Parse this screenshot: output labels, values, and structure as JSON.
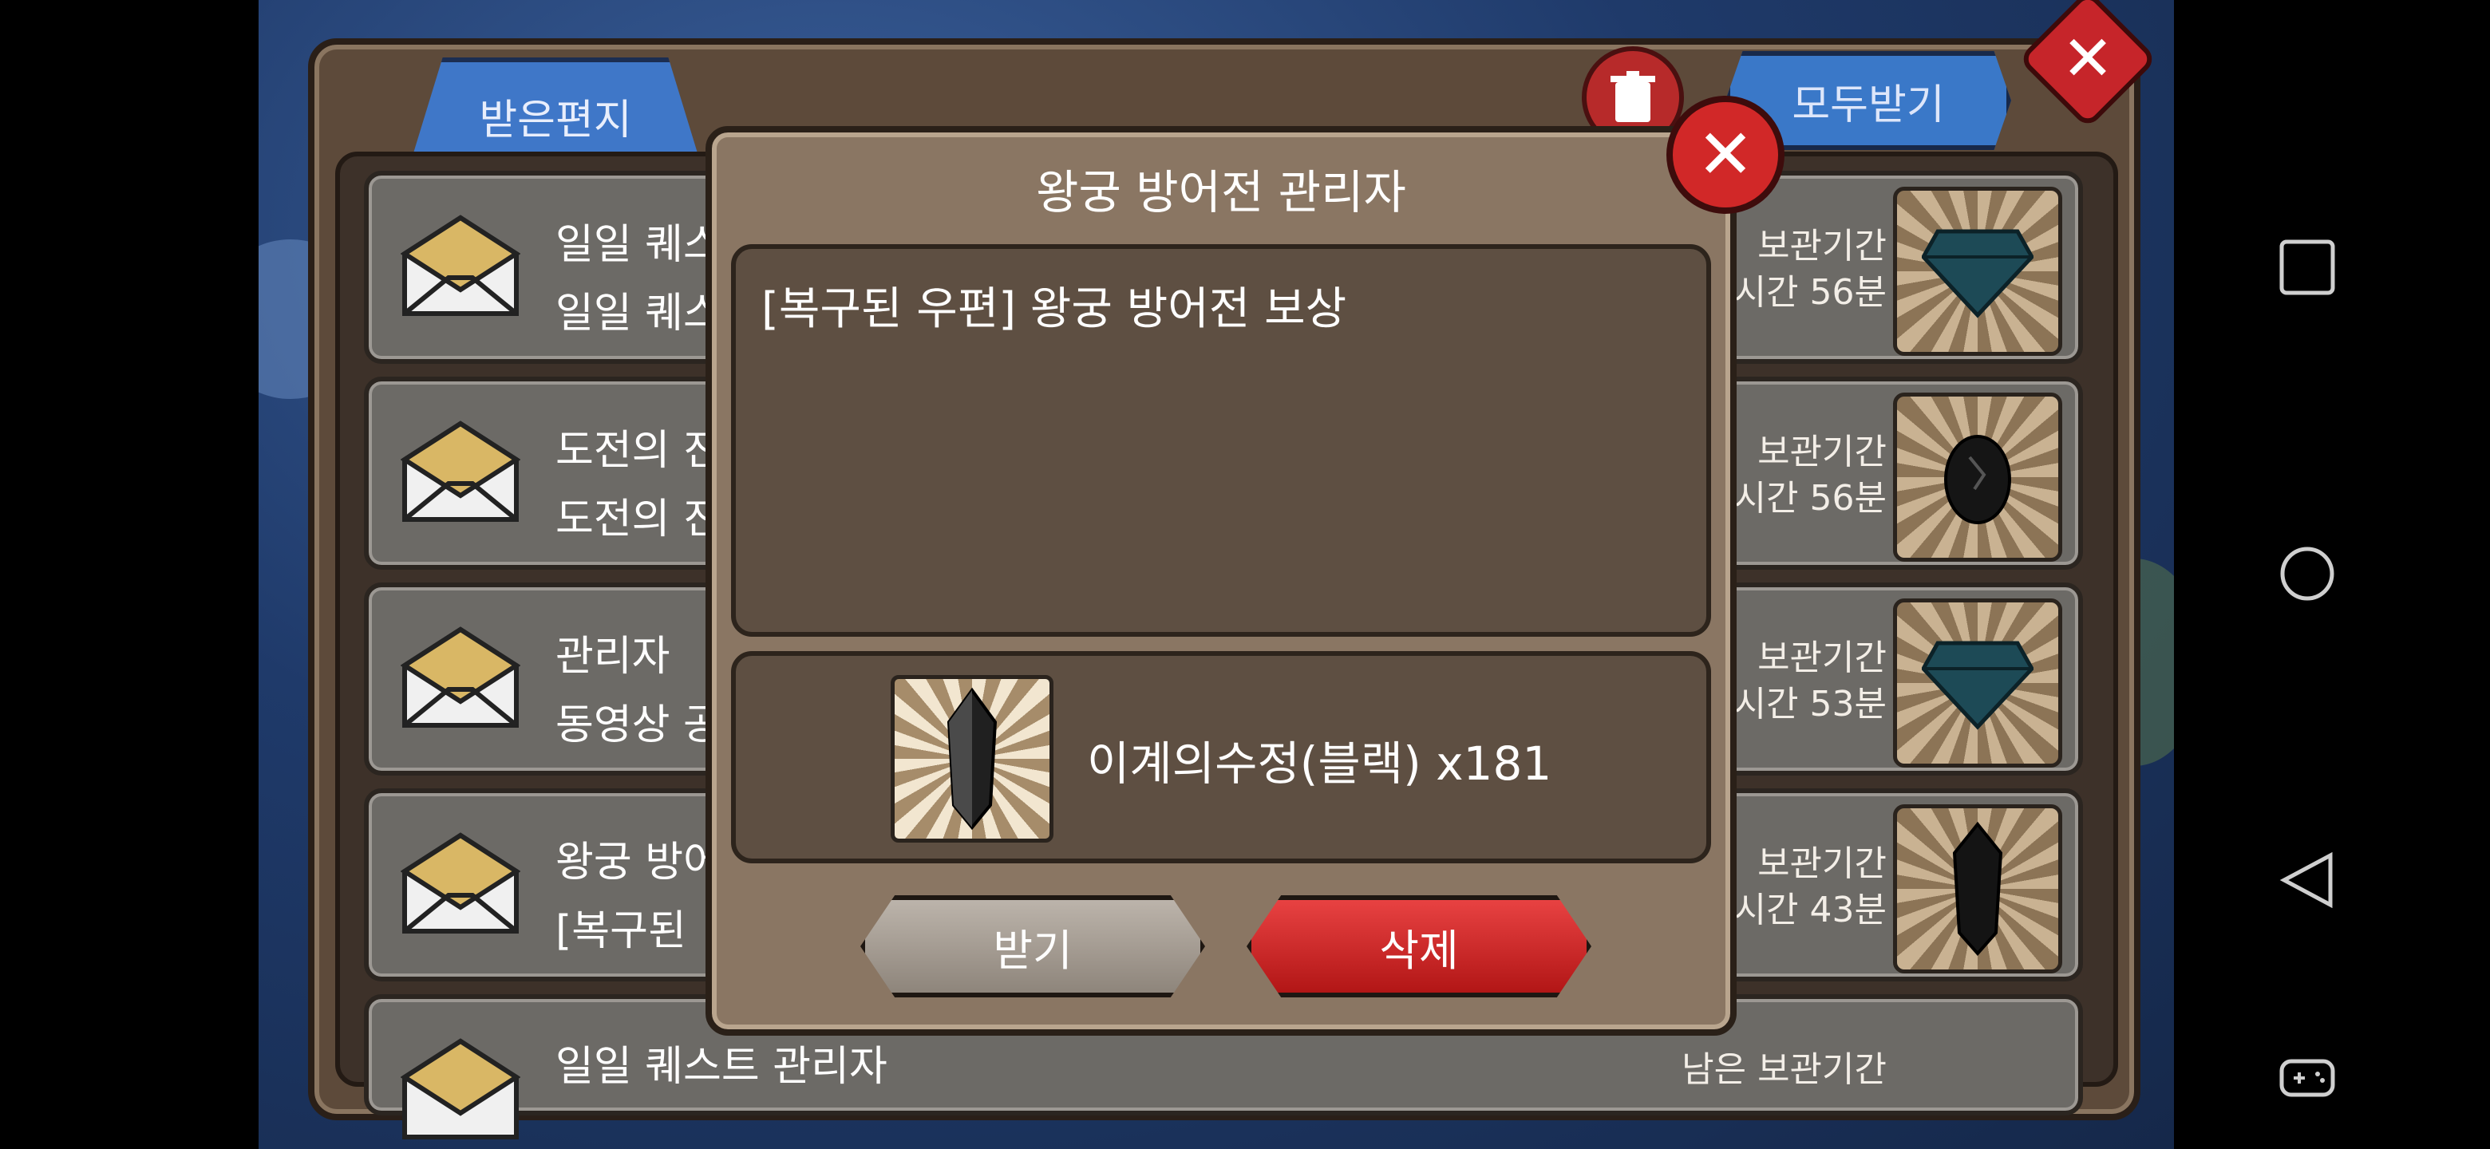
{
  "mail_panel": {
    "tab_label": "받은편지",
    "receive_all_label": "모두받기",
    "rows": [
      {
        "line1": "일일 퀘스",
        "line2": "일일 퀘스",
        "right1": "보관기간",
        "right2": "시간 56분",
        "item_icon": "diamond-icon"
      },
      {
        "line1": "도전의 진",
        "line2": "도전의 진",
        "right1": "보관기간",
        "right2": "시간 56분",
        "item_icon": "egg-icon"
      },
      {
        "line1": "관리자",
        "line2": "동영상 공",
        "right1": "보관기간",
        "right2": "시간 53분",
        "item_icon": "diamond-icon"
      },
      {
        "line1": "왕궁 방어",
        "line2": "[복구된 ",
        "right1": "보관기간",
        "right2": "시간 43분",
        "item_icon": "crystal-icon"
      },
      {
        "line1": "일일 퀘스트 관리자",
        "line2": "",
        "right1": "남은 보관기간",
        "right2": "",
        "item_icon": "diamond-icon"
      }
    ]
  },
  "dialog": {
    "title": "왕궁 방어전 관리자",
    "message": "[복구된 우편] 왕궁 방어전 보상",
    "item_name": "이계의수정(블랙) x181",
    "item_icon": "black-crystal-icon",
    "receive_label": "받기",
    "delete_label": "삭제"
  },
  "colors": {
    "accent_blue": "#3f77c8",
    "delete_red": "#c81e1e",
    "panel_brown": "#8a7663"
  }
}
